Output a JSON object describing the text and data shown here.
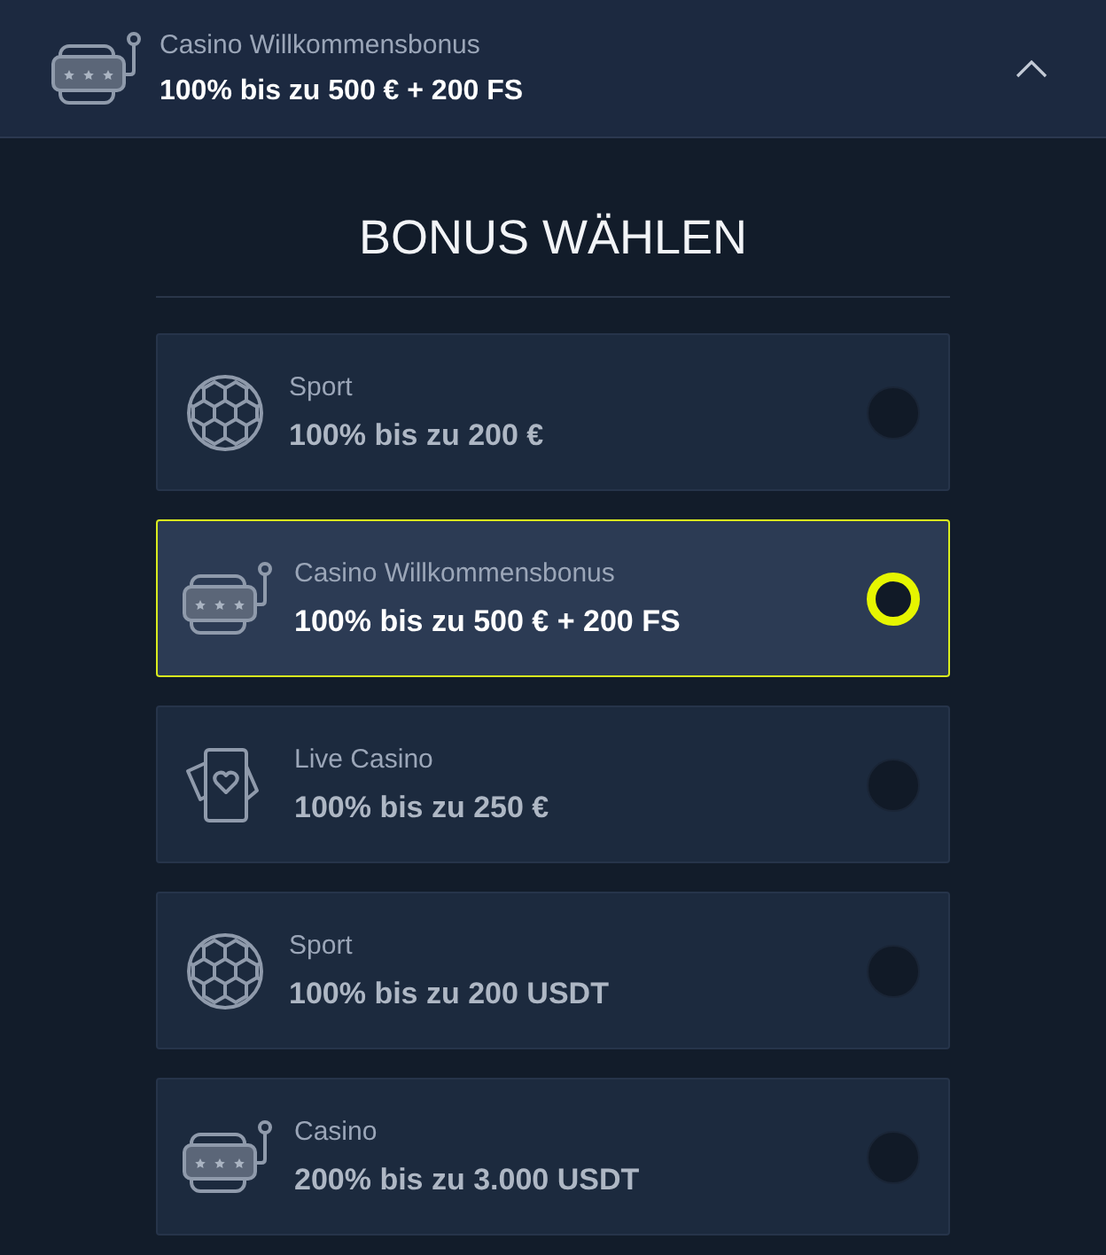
{
  "header": {
    "kind": "casino",
    "label": "Casino Willkommensbonus",
    "amount": "100% bis zu 500 € + 200 FS",
    "expanded": true
  },
  "title": "BONUS WÄHLEN",
  "bonuses": [
    {
      "kind": "sport",
      "label": "Sport",
      "amount": "100% bis zu 200 €",
      "selected": false
    },
    {
      "kind": "casino",
      "label": "Casino Willkommensbonus",
      "amount": "100% bis zu 500 € + 200 FS",
      "selected": true
    },
    {
      "kind": "livecasino",
      "label": "Live Casino",
      "amount": "100% bis zu 250 €",
      "selected": false
    },
    {
      "kind": "sport",
      "label": "Sport",
      "amount": "100% bis zu 200 USDT",
      "selected": false
    },
    {
      "kind": "casino",
      "label": "Casino",
      "amount": "200% bis zu 3.000 USDT",
      "selected": false
    }
  ]
}
